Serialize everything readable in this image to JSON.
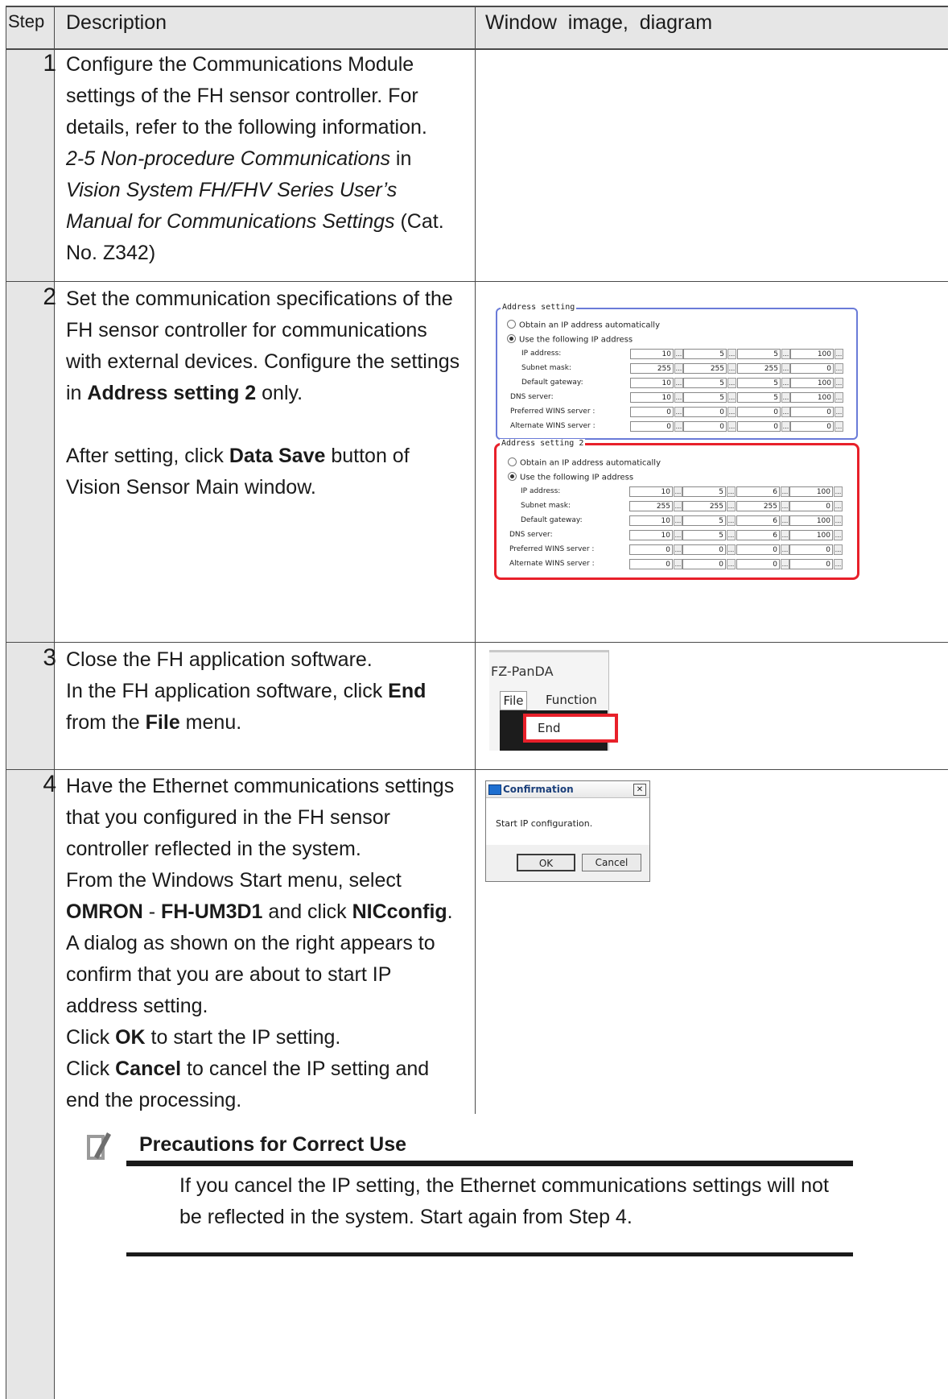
{
  "header": {
    "step": "Step",
    "description": "Description",
    "window": "Window  image,  diagram"
  },
  "steps": [
    {
      "num": "1"
    },
    {
      "num": "2"
    },
    {
      "num": "3"
    },
    {
      "num": "4"
    }
  ],
  "step1": {
    "l1": "Configure the Communications Module",
    "l2": "settings of the FH sensor controller. For",
    "l3": "details, refer to the following information.",
    "l4_italic": "2-5 Non-procedure Communications",
    "l4_rest": " in",
    "l5_italic": "Vision System FH/FHV Series User’s",
    "l6_italic": "Manual for Communications Settings",
    "l6_rest": " (Cat.",
    "l7": "No. Z342)"
  },
  "step2": {
    "l1": "Set the communication specifications of the",
    "l2": "FH sensor controller for communications",
    "l3": "with external devices. Configure the settings",
    "l4_pre": "in ",
    "l4_bold": "Address setting 2",
    "l4_post": " only.",
    "l5_pre": "After setting, click ",
    "l5_bold": "Data Save",
    "l5_post": " button of",
    "l6": "Vision Sensor Main window."
  },
  "step3": {
    "l1": "Close the FH application software.",
    "l2_pre": "In the FH application software, click ",
    "l2_bold": "End",
    "l3_pre": "from the ",
    "l3_bold": "File",
    "l3_post": " menu."
  },
  "step4": {
    "l1": "Have the Ethernet communications settings",
    "l2": "that you configured in the FH sensor",
    "l3": "controller reflected in the system.",
    "l4": "From the Windows Start menu, select",
    "l5_b1": "OMRON",
    "l5_m1": " - ",
    "l5_b2": "FH-UM3D1",
    "l5_m2": " and click ",
    "l5_b3": "NICconfig",
    "l5_m3": ".",
    "l6": "A dialog as shown on the right appears to",
    "l7": "confirm that you are about to start IP",
    "l8": "address setting.",
    "l9_pre": "Click ",
    "l9_bold": "OK",
    "l9_post": " to start the IP setting.",
    "l10_pre": "Click ",
    "l10_bold": "Cancel",
    "l10_post": " to cancel the IP setting and",
    "l11": "end the processing."
  },
  "precaution": {
    "title": "Precautions for Correct Use",
    "l1": "If you cancel the IP setting, the Ethernet communications settings will not",
    "l2": "be reflected in the system. Start again from Step 4."
  },
  "address_panel": {
    "setting1": {
      "legend": "Address setting",
      "auto": "Obtain an IP address automatically",
      "manual": "Use the following IP address",
      "rows": [
        {
          "label": "IP address:",
          "values": [
            "10",
            "5",
            "5",
            "100"
          ]
        },
        {
          "label": "Subnet mask:",
          "values": [
            "255",
            "255",
            "255",
            "0"
          ]
        },
        {
          "label": "Default gateway:",
          "values": [
            "10",
            "5",
            "5",
            "100"
          ]
        },
        {
          "label": "DNS server:",
          "values": [
            "10",
            "5",
            "5",
            "100"
          ]
        },
        {
          "label": "Preferred WINS server :",
          "values": [
            "0",
            "0",
            "0",
            "0"
          ]
        },
        {
          "label": "Alternate WINS server :",
          "values": [
            "0",
            "0",
            "0",
            "0"
          ]
        }
      ]
    },
    "setting2": {
      "legend": "Address setting 2",
      "auto": "Obtain an IP address automatically",
      "manual": "Use the following IP address",
      "rows": [
        {
          "label": "IP address:",
          "values": [
            "10",
            "5",
            "6",
            "100"
          ]
        },
        {
          "label": "Subnet mask:",
          "values": [
            "255",
            "255",
            "255",
            "0"
          ]
        },
        {
          "label": "Default gateway:",
          "values": [
            "10",
            "5",
            "6",
            "100"
          ]
        },
        {
          "label": "DNS server:",
          "values": [
            "10",
            "5",
            "6",
            "100"
          ]
        },
        {
          "label": "Preferred WINS server :",
          "values": [
            "0",
            "0",
            "0",
            "0"
          ]
        },
        {
          "label": "Alternate WINS server :",
          "values": [
            "0",
            "0",
            "0",
            "0"
          ]
        }
      ]
    },
    "dots": "..."
  },
  "menu_panel": {
    "app_title": "FZ-PanDA",
    "file": "File",
    "function": "Function",
    "end": "End"
  },
  "dialog": {
    "title": "Confirmation",
    "close": "✕",
    "message": "Start IP configuration.",
    "ok": "OK",
    "cancel": "Cancel"
  },
  "colors": {
    "highlight_red": "#e8202a",
    "frame_blue": "#6a7bd8",
    "header_bg": "#e6e6e6",
    "step_col_bg": "#e6e6e6"
  }
}
